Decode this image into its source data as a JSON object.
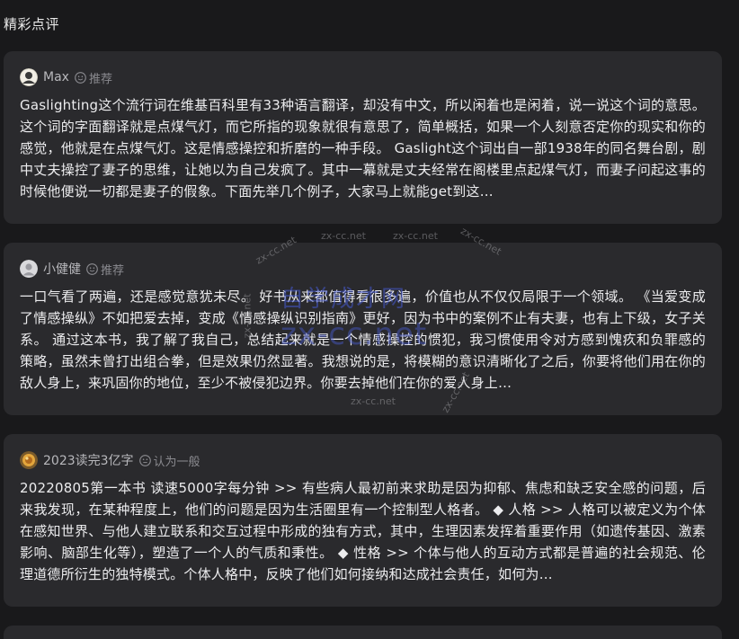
{
  "section": {
    "title": "精彩点评"
  },
  "reviews": [
    {
      "user": "Max",
      "rating_icon": "smile-icon",
      "rating": "推荐",
      "text": "Gaslighting这个流行词在维基百科里有33种语言翻译，却没有中文，所以闲着也是闲着，说一说这个词的意思。 这个词的字面翻译就是点煤气灯，而它所指的现象就很有意思了，简单概括，如果一个人刻意否定你的现实和你的感觉，他就是在点煤气灯。这是情感操控和折磨的一种手段。 Gaslight这个词出自一部1938年的同名舞台剧，剧中丈夫操控了妻子的思维，让她以为自己发疯了。其中一幕就是丈夫经常在阁楼里点起煤气灯，而妻子问起这事的时候他便说一切都是妻子的假象。下面先举几个例子，大家马上就能get到这…"
    },
    {
      "user": "小健健",
      "rating_icon": "smile-icon",
      "rating": "推荐",
      "text": "一口气看了两遍，还是感觉意犹未尽。 好书从来都值得看很多遍，价值也从不仅仅局限于一个领域。 《当爱变成了情感操纵》不如把爱去掉，变成《情感操纵识别指南》更好，因为书中的案例不止有夫妻，也有上下级，女子关系。 通过这本书，我了解了我自己，总结起来就是一个情感操控的惯犯，我习惯使用令对方感到愧疚和负罪感的策略，虽然未曾打出组合拳，但是效果仍然显著。我想说的是，将模糊的意识清晰化了之后，你要将他们用在你的敌人身上，来巩固你的地位，至少不被侵犯边界。你要去掉他们在你的爱人身上…"
    },
    {
      "user": "2023读完3亿字",
      "rating_icon": "neutral-face-icon",
      "rating": "认为一般",
      "text": "20220805第一本书 读速5000字每分钟 >> 有些病人最初前来求助是因为抑郁、焦虑和缺乏安全感的问题，后来我发现，在某种程度上，他们的问题是因为生活圈里有一个控制型人格者。 ◆ 人格 >> 人格可以被定义为个体在感知世界、与他人建立联系和交互过程中形成的独有方式，其中，生理因素发挥着重要作用（如遗传基因、激素影响、脑部生化等），塑造了一个人的气质和秉性。 ◆ 性格 >> 个体与他人的互动方式都是普遍的社会规范、伦理道德所衍生的独特模式。个体人格中，反映了他们如何接纳和达成社会责任，如何为…"
    }
  ],
  "watermarks": {
    "small": "zx-cc.net",
    "brand": "自学成才网",
    "url": "zx-cc.net"
  }
}
